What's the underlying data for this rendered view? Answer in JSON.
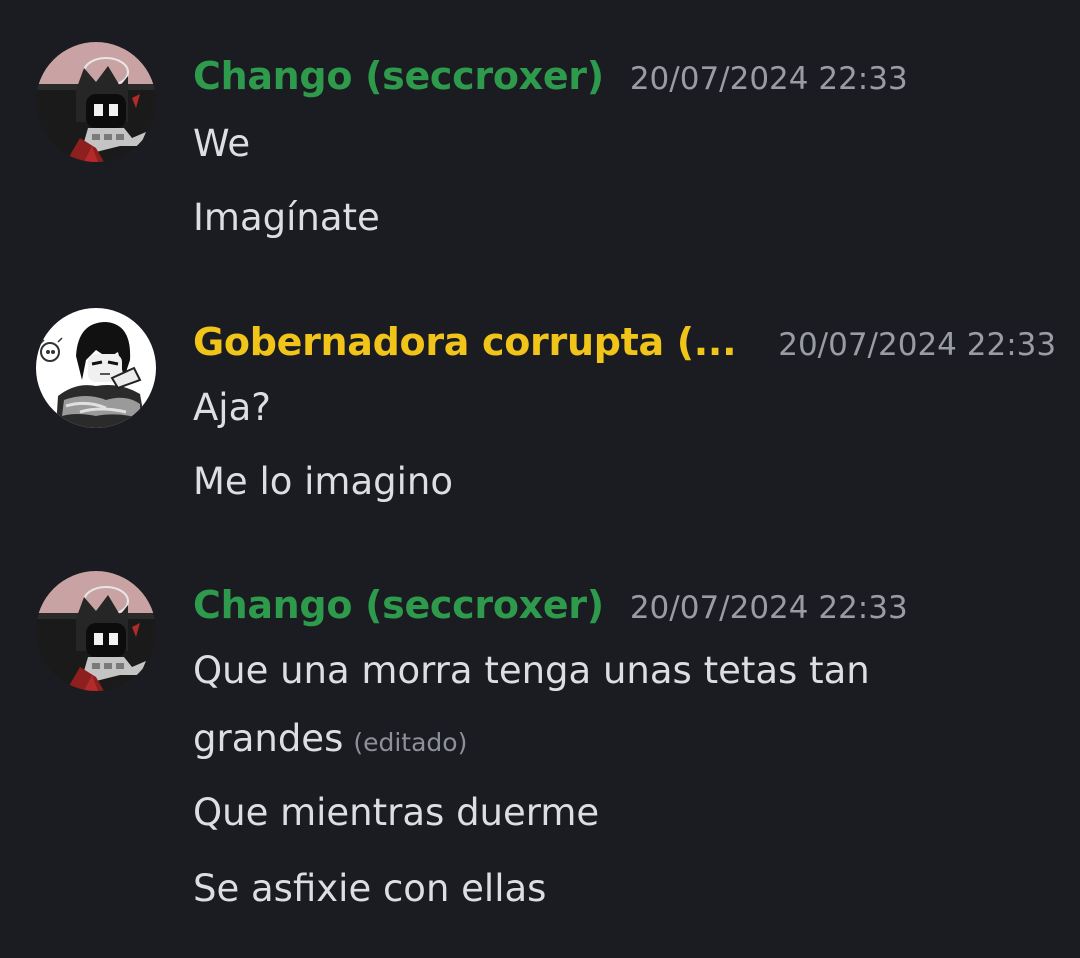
{
  "colors": {
    "background": "#1b1c21",
    "text": "#dcdee1",
    "timestamp": "#9a9ca5",
    "username_chango": "#2e9a4c",
    "username_gobernadora": "#f0c419"
  },
  "messages": [
    {
      "username": "Chango (seccroxer)",
      "timestamp": "20/07/2024 22:33",
      "avatar": "chango-avatar-icon",
      "lines": [
        "We",
        "Imagínate"
      ]
    },
    {
      "username": "Gobernadora corrupta (...",
      "timestamp": "20/07/2024 22:33",
      "avatar": "gobernadora-avatar-icon",
      "lines": [
        "Aja?",
        "Me lo imagino"
      ]
    },
    {
      "username": "Chango (seccroxer)",
      "timestamp": "20/07/2024 22:33",
      "avatar": "chango-avatar-icon",
      "lines": [
        "Que una morra tenga unas tetas tan",
        "grandes",
        "Que mientras duerme",
        "Se asfixie con ellas"
      ],
      "edited_label": "(editado)"
    }
  ]
}
